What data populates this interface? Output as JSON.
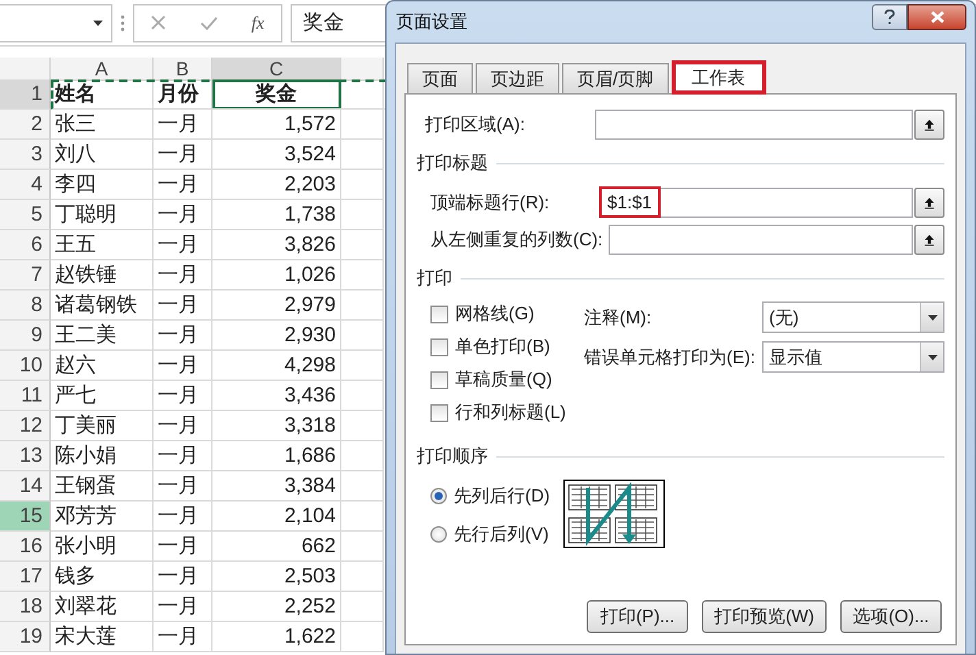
{
  "formula_bar": {
    "function_label": "fx",
    "formula": "奖金"
  },
  "sheet": {
    "copy_marquee": true,
    "columns": [
      {
        "label": "A",
        "selected": false
      },
      {
        "label": "B",
        "selected": false
      },
      {
        "label": "C",
        "selected": true
      }
    ],
    "rows": [
      {
        "number": "1",
        "selected": true,
        "highlighted": false,
        "kind": "header",
        "cells": [
          "姓名",
          "月份",
          "奖金"
        ]
      },
      {
        "number": "2",
        "selected": false,
        "highlighted": false,
        "kind": "data",
        "cells": [
          "张三",
          "一月",
          "1,572"
        ]
      },
      {
        "number": "3",
        "selected": false,
        "highlighted": false,
        "kind": "data",
        "cells": [
          "刘八",
          "一月",
          "3,524"
        ]
      },
      {
        "number": "4",
        "selected": false,
        "highlighted": false,
        "kind": "data",
        "cells": [
          "李四",
          "一月",
          "2,203"
        ]
      },
      {
        "number": "5",
        "selected": false,
        "highlighted": false,
        "kind": "data",
        "cells": [
          "丁聪明",
          "一月",
          "1,738"
        ]
      },
      {
        "number": "6",
        "selected": false,
        "highlighted": false,
        "kind": "data",
        "cells": [
          "王五",
          "一月",
          "3,826"
        ]
      },
      {
        "number": "7",
        "selected": false,
        "highlighted": false,
        "kind": "data",
        "cells": [
          "赵铁锤",
          "一月",
          "1,026"
        ]
      },
      {
        "number": "8",
        "selected": false,
        "highlighted": false,
        "kind": "data",
        "cells": [
          "诸葛钢铁",
          "一月",
          "2,979"
        ]
      },
      {
        "number": "9",
        "selected": false,
        "highlighted": false,
        "kind": "data",
        "cells": [
          "王二美",
          "一月",
          "2,930"
        ]
      },
      {
        "number": "10",
        "selected": false,
        "highlighted": false,
        "kind": "data",
        "cells": [
          "赵六",
          "一月",
          "4,298"
        ]
      },
      {
        "number": "11",
        "selected": false,
        "highlighted": false,
        "kind": "data",
        "cells": [
          "严七",
          "一月",
          "3,436"
        ]
      },
      {
        "number": "12",
        "selected": false,
        "highlighted": false,
        "kind": "data",
        "cells": [
          "丁美丽",
          "一月",
          "3,318"
        ]
      },
      {
        "number": "13",
        "selected": false,
        "highlighted": false,
        "kind": "data",
        "cells": [
          "陈小娟",
          "一月",
          "1,686"
        ]
      },
      {
        "number": "14",
        "selected": false,
        "highlighted": false,
        "kind": "data",
        "cells": [
          "王钢蛋",
          "一月",
          "3,384"
        ]
      },
      {
        "number": "15",
        "selected": false,
        "highlighted": true,
        "kind": "data",
        "cells": [
          "邓芳芳",
          "一月",
          "2,104"
        ]
      },
      {
        "number": "16",
        "selected": false,
        "highlighted": false,
        "kind": "data",
        "cells": [
          "张小明",
          "一月",
          "662"
        ]
      },
      {
        "number": "17",
        "selected": false,
        "highlighted": false,
        "kind": "data",
        "cells": [
          "钱多",
          "一月",
          "2,503"
        ]
      },
      {
        "number": "18",
        "selected": false,
        "highlighted": false,
        "kind": "data",
        "cells": [
          "刘翠花",
          "一月",
          "2,252"
        ]
      },
      {
        "number": "19",
        "selected": false,
        "highlighted": false,
        "kind": "data",
        "cells": [
          "宋大莲",
          "一月",
          "1,622"
        ]
      }
    ]
  },
  "dialog": {
    "title": "页面设置",
    "tabs": [
      {
        "label": "页面",
        "selected": false,
        "highlighted": false
      },
      {
        "label": "页边距",
        "selected": false,
        "highlighted": false
      },
      {
        "label": "页眉/页脚",
        "selected": false,
        "highlighted": false
      },
      {
        "label": "工作表",
        "selected": true,
        "highlighted": true
      }
    ],
    "print_area": {
      "label": "打印区域(A):"
    },
    "print_titles": {
      "heading": "打印标题",
      "rows_to_repeat": {
        "label": "顶端标题行(R):",
        "value": "$1:$1",
        "highlighted": true
      },
      "columns_to_repeat": {
        "label": "从左侧重复的列数(C):"
      }
    },
    "print": {
      "heading": "打印",
      "options": [
        {
          "label": "网格线(G)",
          "checked": false
        },
        {
          "label": "单色打印(B)",
          "checked": false
        },
        {
          "label": "草稿质量(Q)",
          "checked": false
        },
        {
          "label": "行和列标题(L)",
          "checked": false
        }
      ],
      "comments": {
        "label": "注释(M):",
        "value": "(无)"
      },
      "cell_errors": {
        "label": "错误单元格打印为(E):",
        "value": "显示值"
      }
    },
    "page_order": {
      "heading": "打印顺序",
      "options": [
        {
          "label": "先列后行(D)",
          "selected": true
        },
        {
          "label": "先行后列(V)",
          "selected": false
        }
      ]
    },
    "buttons": [
      "打印(P)...",
      "打印预览(W)",
      "选项(O)..."
    ]
  }
}
